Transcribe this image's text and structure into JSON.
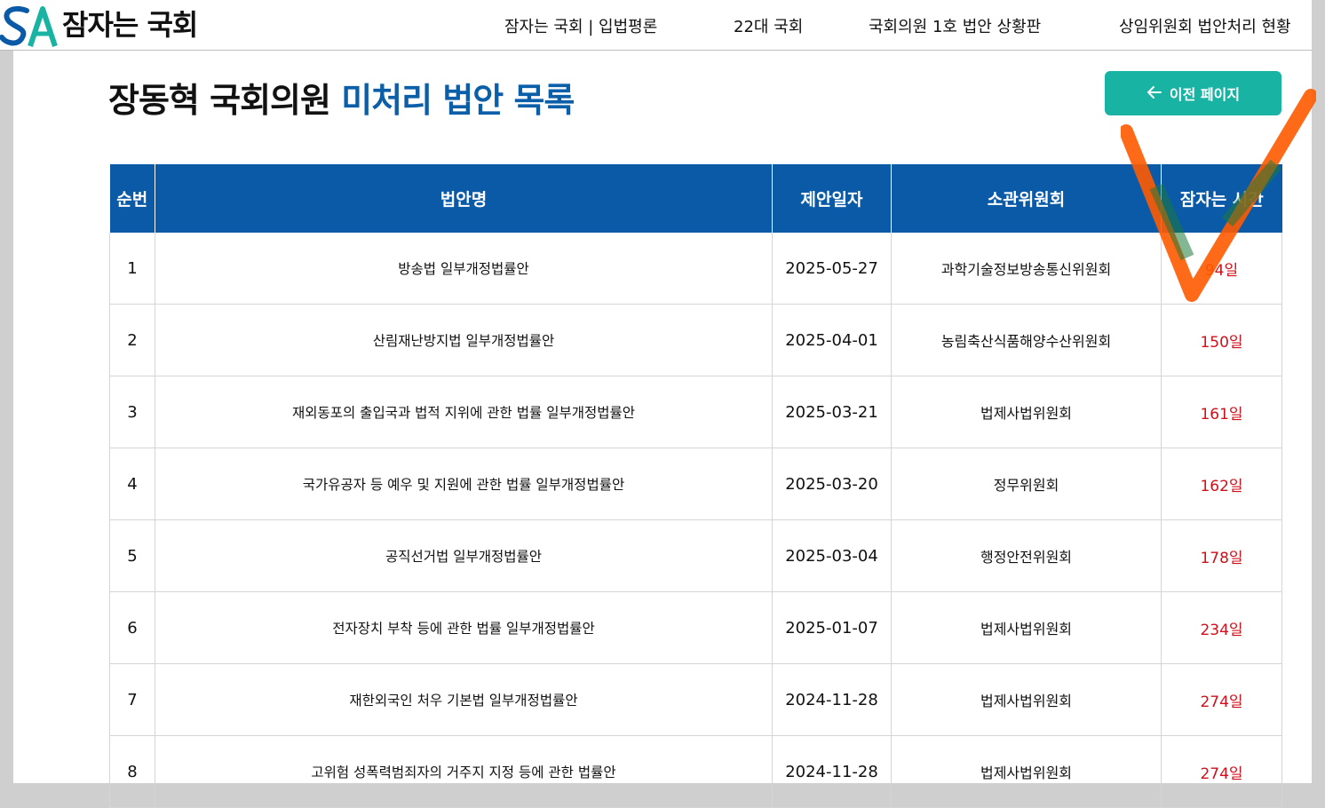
{
  "header": {
    "logo_text": "잠자는 국회",
    "nav": [
      "잠자는 국회 | 입법평론",
      "22대 국회",
      "국회의원 1호 법안 상황판",
      "상임위원회 법안처리 현황"
    ]
  },
  "page": {
    "title_part1": "장동혁 국회의원 ",
    "title_part2": "미처리 법안 목록",
    "back_button_label": "이전 페이지"
  },
  "table": {
    "headers": [
      "순번",
      "법안명",
      "제안일자",
      "소관위원회",
      "잠자는 시간"
    ],
    "rows": [
      {
        "no": "1",
        "name": "방송법 일부개정법률안",
        "date": "2025-05-27",
        "committee": "과학기술정보방송통신위원회",
        "wait": "94일"
      },
      {
        "no": "2",
        "name": "산림재난방지법 일부개정법률안",
        "date": "2025-04-01",
        "committee": "농림축산식품해양수산위원회",
        "wait": "150일"
      },
      {
        "no": "3",
        "name": "재외동포의 출입국과 법적 지위에 관한 법률 일부개정법률안",
        "date": "2025-03-21",
        "committee": "법제사법위원회",
        "wait": "161일"
      },
      {
        "no": "4",
        "name": "국가유공자 등 예우 및 지원에 관한 법률 일부개정법률안",
        "date": "2025-03-20",
        "committee": "정무위원회",
        "wait": "162일"
      },
      {
        "no": "5",
        "name": "공직선거법 일부개정법률안",
        "date": "2025-03-04",
        "committee": "행정안전위원회",
        "wait": "178일"
      },
      {
        "no": "6",
        "name": "전자장치 부착 등에 관한 법률 일부개정법률안",
        "date": "2025-01-07",
        "committee": "법제사법위원회",
        "wait": "234일"
      },
      {
        "no": "7",
        "name": "재한외국인 처우 기본법 일부개정법률안",
        "date": "2024-11-28",
        "committee": "법제사법위원회",
        "wait": "274일"
      },
      {
        "no": "8",
        "name": "고위험 성폭력범죄자의 거주지 지정 등에 관한 법률안",
        "date": "2024-11-28",
        "committee": "법제사법위원회",
        "wait": "274일"
      }
    ]
  },
  "colors": {
    "header_blue": "#0b5aa8",
    "title_highlight": "#0b5ea8",
    "button_teal": "#18b3a3",
    "wait_red": "#d0111b",
    "check_orange": "#ff5a00",
    "check_green": "#1e7a3a"
  }
}
